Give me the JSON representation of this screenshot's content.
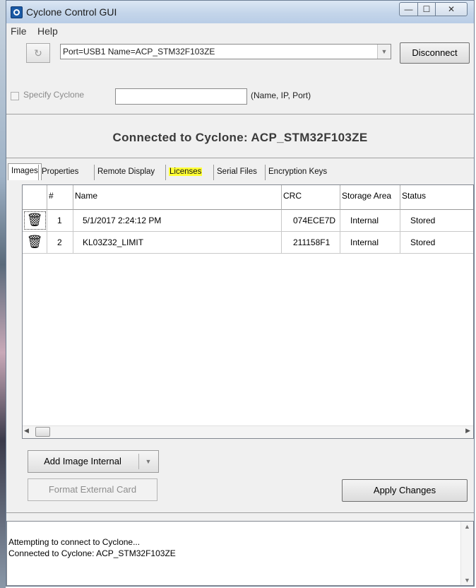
{
  "window": {
    "title": "Cyclone Control GUI",
    "min_glyph": "—",
    "max_glyph": "☐",
    "close_glyph": "✕"
  },
  "menu": [
    "File",
    "Help"
  ],
  "connection": {
    "refresh_icon": "↻",
    "port_value": "Port=USB1   Name=ACP_STM32F103ZE",
    "disconnect_label": "Disconnect",
    "specify_label": "Specify Cyclone",
    "specify_value": "",
    "specify_hint": "(Name, IP, Port)"
  },
  "status_heading": "Connected to Cyclone: ACP_STM32F103ZE",
  "tabs": [
    "Images",
    "Properties",
    "Remote Display",
    "Licenses",
    "Serial Files",
    "Encryption Keys"
  ],
  "table": {
    "columns": [
      "",
      "#",
      "Name",
      "CRC",
      "Storage Area",
      "Status"
    ],
    "rows": [
      {
        "num": "1",
        "name": "5/1/2017 2:24:12 PM",
        "crc": "074ECE7D",
        "storage": "Internal",
        "status": "Stored"
      },
      {
        "num": "2",
        "name": "KL03Z32_LIMIT",
        "crc": "211158F1",
        "storage": "Internal",
        "status": "Stored"
      }
    ]
  },
  "buttons": {
    "add_image": "Add Image Internal",
    "format_card": "Format External Card",
    "apply": "Apply Changes"
  },
  "log": {
    "lines": [
      "Attempting to connect to Cyclone...",
      "Connected to Cyclone: ACP_STM32F103ZE"
    ]
  },
  "colors": {
    "highlight": "#ffff33",
    "title_bar": "#c4d5ea"
  }
}
